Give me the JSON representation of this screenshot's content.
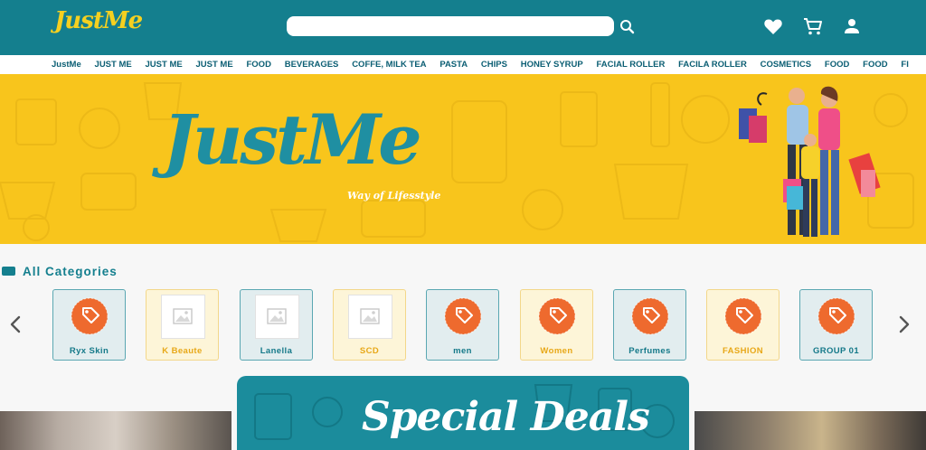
{
  "header": {
    "logo_text": "JustMe",
    "search": {
      "value": "",
      "placeholder": ""
    },
    "icons": [
      "search-icon",
      "heart-icon",
      "cart-icon",
      "user-icon"
    ]
  },
  "nav": {
    "items": [
      "JustMe",
      "JUST ME",
      "JUST ME",
      "JUST ME",
      "FOOD",
      "BEVERAGES",
      "COFFE, MILK  TEA",
      "PASTA",
      "CHIPS",
      "HONEY SYRUP",
      "FACIAL ROLLER",
      "FACILA ROLLER",
      "COSMETICS",
      "FOOD",
      "FOOD",
      "FI"
    ]
  },
  "banner": {
    "title": "JustMe",
    "subtitle": "Way of Lifesstyle"
  },
  "categories": {
    "title": "All Categories",
    "items": [
      {
        "label": "Ryx Skin",
        "style": "teal",
        "icon": "tag-icon"
      },
      {
        "label": "K Beaute",
        "style": "yellow",
        "icon": "image-placeholder-icon"
      },
      {
        "label": "Lanella",
        "style": "teal",
        "icon": "image-placeholder-icon"
      },
      {
        "label": "SCD",
        "style": "yellow",
        "icon": "image-placeholder-icon"
      },
      {
        "label": "men",
        "style": "teal",
        "icon": "tag-icon"
      },
      {
        "label": "Women",
        "style": "yellow",
        "icon": "tag-icon"
      },
      {
        "label": "Perfumes",
        "style": "teal",
        "icon": "tag-icon"
      },
      {
        "label": "FASHION",
        "style": "yellow",
        "icon": "tag-icon"
      },
      {
        "label": "GROUP 01",
        "style": "teal",
        "icon": "tag-icon"
      }
    ]
  },
  "deals": {
    "title": "Special Deals"
  },
  "colors": {
    "brand_teal": "#147f8e",
    "brand_yellow": "#f8c51c",
    "tag_orange": "#ee6a2e"
  }
}
